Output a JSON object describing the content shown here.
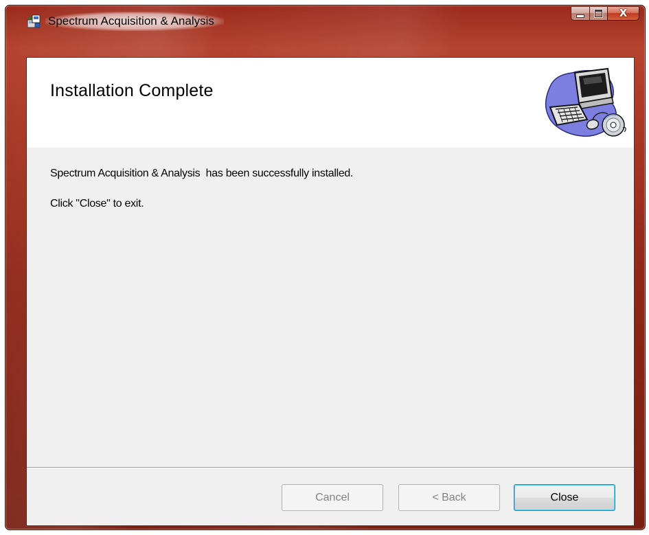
{
  "window": {
    "title": "Spectrum Acquisition & Analysis",
    "frame_color": "#a3301e"
  },
  "title_bar": {
    "app_icon": "installer-package-icon",
    "buttons": [
      {
        "id": "minimize",
        "icon": "minimize-icon"
      },
      {
        "id": "maximize",
        "icon": "maximize-icon"
      },
      {
        "id": "close",
        "icon": "close-icon",
        "glyph": "X"
      }
    ]
  },
  "banner": {
    "heading": "Installation Complete",
    "art_icon": "computer-with-cd-icon"
  },
  "body": {
    "line1": "Spectrum Acquisition & Analysis  has been successfully installed.",
    "line2": "Click \"Close\" to exit."
  },
  "footer": {
    "buttons": {
      "cancel": {
        "label": "Cancel",
        "enabled": false
      },
      "back": {
        "label": "< Back",
        "enabled": false
      },
      "close": {
        "label": "Close",
        "enabled": true,
        "default": true
      }
    }
  }
}
